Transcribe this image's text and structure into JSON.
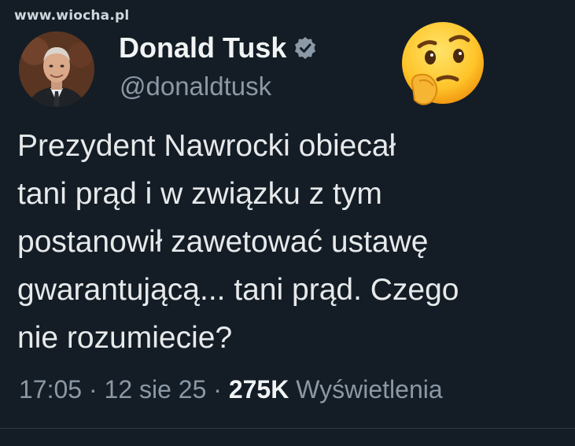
{
  "watermark": "www.wiocha.pl",
  "author": {
    "name": "Donald Tusk",
    "handle": "@donaldtusk",
    "verified": true
  },
  "reaction_emoji": "thinking-face",
  "tweet": {
    "lines": [
      "Prezydent Nawrocki obiecał",
      "tani prąd i w związku z tym",
      "postanowił zawetować ustawę",
      "gwarantującą... tani prąd. Czego",
      "nie rozumiecie?"
    ]
  },
  "meta": {
    "time": "17:05",
    "sep1": " · ",
    "date": "12 sie 25",
    "sep2": " · ",
    "views_count": "275K",
    "views_label": " Wyświetlenia"
  },
  "colors": {
    "background": "#141d26",
    "text": "#e7e9ea",
    "muted": "#8b98a5",
    "verified_badge": "#8b98a5"
  }
}
